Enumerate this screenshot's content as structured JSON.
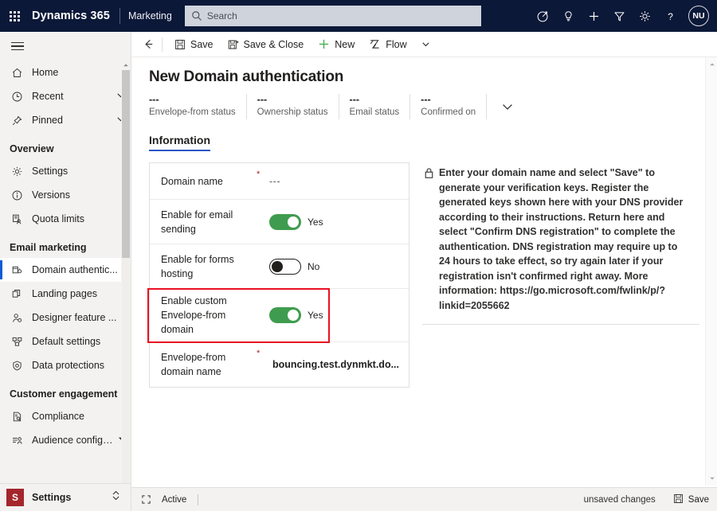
{
  "topbar": {
    "waffle_label": "app-launcher",
    "brand": "Dynamics 365",
    "app_name": "Marketing",
    "search_placeholder": "Search",
    "icons": [
      {
        "name": "target-icon",
        "label": "Focused mode"
      },
      {
        "name": "lightbulb-icon",
        "label": "Insights"
      },
      {
        "name": "plus-icon",
        "label": "Quick create"
      },
      {
        "name": "filter-icon",
        "label": "Filter"
      },
      {
        "name": "gear-icon",
        "label": "Settings"
      },
      {
        "name": "question-icon",
        "label": "Help"
      }
    ],
    "avatar_initials": "NU",
    "background_color": "#0b1838"
  },
  "sidebar": {
    "items": [
      {
        "label": "Home",
        "icon": "home-icon",
        "chevron": false,
        "selected": false
      },
      {
        "label": "Recent",
        "icon": "clock-icon",
        "chevron": true,
        "selected": false
      },
      {
        "label": "Pinned",
        "icon": "pin-icon",
        "chevron": true,
        "selected": false
      }
    ],
    "groups": [
      {
        "title": "Overview",
        "items": [
          {
            "label": "Settings",
            "icon": "gear-icon",
            "selected": false
          },
          {
            "label": "Versions",
            "icon": "info-icon",
            "selected": false
          },
          {
            "label": "Quota limits",
            "icon": "quota-icon",
            "selected": false
          }
        ]
      },
      {
        "title": "Email marketing",
        "items": [
          {
            "label": "Domain authentic...",
            "icon": "domain-icon",
            "selected": true
          },
          {
            "label": "Landing pages",
            "icon": "pages-icon",
            "selected": false
          },
          {
            "label": "Designer feature ...",
            "icon": "person-icon",
            "selected": false
          },
          {
            "label": "Default settings",
            "icon": "grid-icon",
            "selected": false
          },
          {
            "label": "Data protections",
            "icon": "shield-icon",
            "selected": false
          }
        ]
      },
      {
        "title": "Customer engagement",
        "items": [
          {
            "label": "Compliance",
            "icon": "document-icon",
            "selected": false
          },
          {
            "label": "Audience configur...",
            "icon": "audience-icon",
            "selected": false
          }
        ]
      }
    ],
    "footer": {
      "tile": "S",
      "label": "Settings",
      "tile_color": "#a4262c"
    },
    "accent_color": "#0b5cd5"
  },
  "commandbar": {
    "back_label": "Back",
    "buttons": [
      {
        "label": "Save",
        "icon": "save-icon"
      },
      {
        "label": "Save & Close",
        "icon": "save-close-icon"
      },
      {
        "label": "New",
        "icon": "plus-icon"
      },
      {
        "label": "Flow",
        "icon": "flow-icon"
      }
    ],
    "overflow_label": "More commands"
  },
  "page": {
    "title": "New Domain authentication",
    "header_stats": [
      {
        "value": "---",
        "label": "Envelope-from status"
      },
      {
        "value": "---",
        "label": "Ownership status"
      },
      {
        "value": "---",
        "label": "Email status"
      },
      {
        "value": "---",
        "label": "Confirmed on"
      }
    ],
    "tabs": [
      {
        "label": "Information",
        "active": true
      }
    ]
  },
  "form": {
    "rows": [
      {
        "label": "Domain name",
        "required": "*",
        "type": "text",
        "value": "---"
      },
      {
        "label": "Enable for email sending",
        "required": "",
        "type": "toggle",
        "toggle_state": "on",
        "value": "Yes"
      },
      {
        "label": "Enable for forms hosting",
        "required": "",
        "type": "toggle",
        "toggle_state": "off",
        "value": "No"
      },
      {
        "label": "Enable custom Envelope-from domain",
        "required": "",
        "type": "toggle",
        "toggle_state": "on",
        "value": "Yes",
        "highlighted": true
      },
      {
        "label": "Envelope-from domain name",
        "required": "*",
        "type": "text",
        "value": "bouncing.test.dynmkt.do..."
      }
    ],
    "highlight_color": "#e81123",
    "toggle_on_color": "#3f9c4e"
  },
  "info_panel": {
    "icon": "lock-icon",
    "text": "Enter your domain name and select \"Save\" to generate your verification keys. Register the generated keys shown here with your DNS provider according to their instructions. Return here and select \"Confirm DNS registration\" to complete the authentication. DNS registration may require up to 24 hours to take effect, so try again later if your registration isn't confirmed right away. More information: https://go.microsoft.com/fwlink/p/?linkid=2055662"
  },
  "statusbar": {
    "expand_icon": "expand-icon",
    "state": "Active",
    "unsaved": "unsaved changes",
    "save_label": "Save",
    "save_icon": "save-icon"
  }
}
